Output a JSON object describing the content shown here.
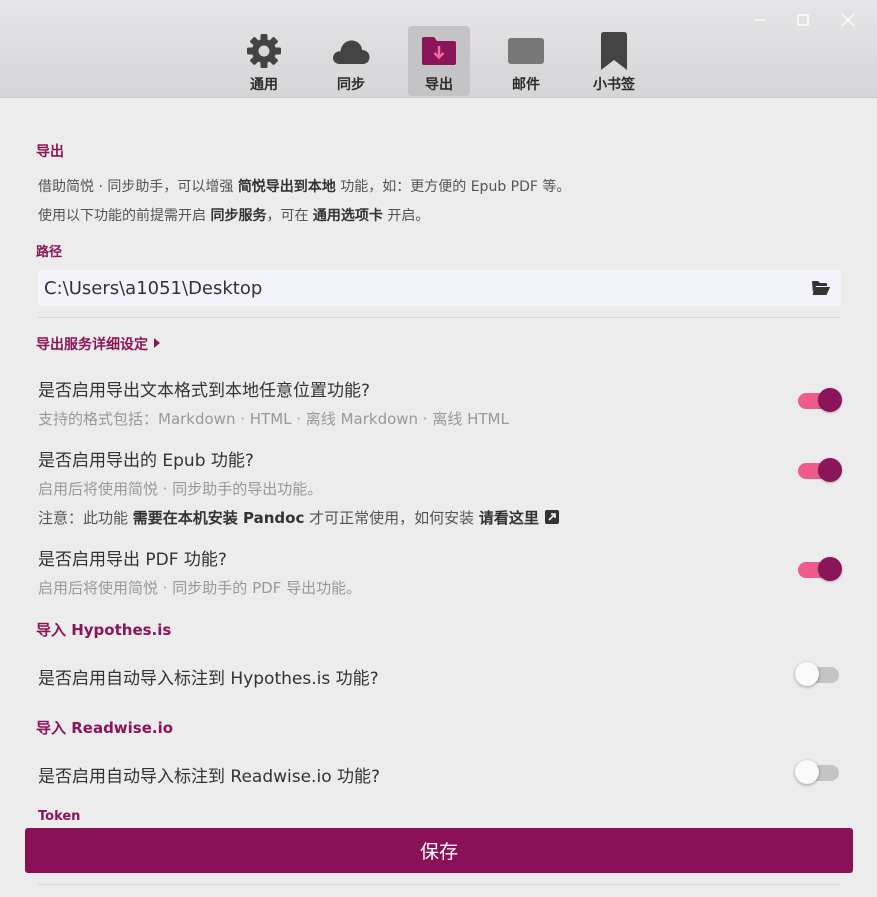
{
  "window": {
    "controls": [
      "minimize",
      "maximize",
      "close"
    ]
  },
  "tabs": [
    {
      "label": "通用",
      "icon": "gear-icon",
      "active": false
    },
    {
      "label": "同步",
      "icon": "cloud-icon",
      "active": false
    },
    {
      "label": "导出",
      "icon": "folder-download-icon",
      "active": true
    },
    {
      "label": "邮件",
      "icon": "mail-icon",
      "active": false
    },
    {
      "label": "小书签",
      "icon": "bookmark-icon",
      "active": false
    }
  ],
  "export": {
    "title": "导出",
    "desc1": {
      "a": "借助简悦 · 同步助手，可以增强 ",
      "b": "简悦导出到本地",
      "c": " 功能，如：更方便的 Epub PDF 等。"
    },
    "desc2": {
      "a": "使用以下功能的前提需开启 ",
      "b": "同步服务",
      "c": "，可在 ",
      "d": "通用选项卡",
      "e": " 开启。"
    }
  },
  "path": {
    "label": "路径",
    "value": "C:\\Users\\a1051\\Desktop"
  },
  "details": {
    "label": "导出服务详细设定"
  },
  "options": {
    "text_export": {
      "title": "是否启用导出文本格式到本地任意位置功能?",
      "sub": "支持的格式包括：Markdown · HTML · 离线 Markdown · 离线 HTML",
      "enabled": true
    },
    "epub": {
      "title": "是否启用导出的 Epub 功能?",
      "sub": "启用后将使用简悦 · 同步助手的导出功能。",
      "note": {
        "a": "注意：此功能 ",
        "b": "需要在本机安装 Pandoc",
        "c": " 才可正常使用，如何安装 ",
        "d": "请看这里"
      },
      "enabled": true
    },
    "pdf": {
      "title": "是否启用导出 PDF 功能?",
      "sub": "启用后将使用简悦 · 同步助手的 PDF 导出功能。",
      "enabled": true
    }
  },
  "hypothesis": {
    "title": "导入 Hypothes.is",
    "option": "是否启用自动导入标注到 Hypothes.is 功能?",
    "enabled": false
  },
  "readwise": {
    "title": "导入 Readwise.io",
    "option": "是否启用自动导入标注到 Readwise.io 功能?",
    "enabled": false,
    "token_label": "Token"
  },
  "save_label": "保存",
  "colors": {
    "accent": "#8a1558",
    "toggle_on_track": "#ef5b8e",
    "toggle_off_track": "#c4c4c4"
  }
}
